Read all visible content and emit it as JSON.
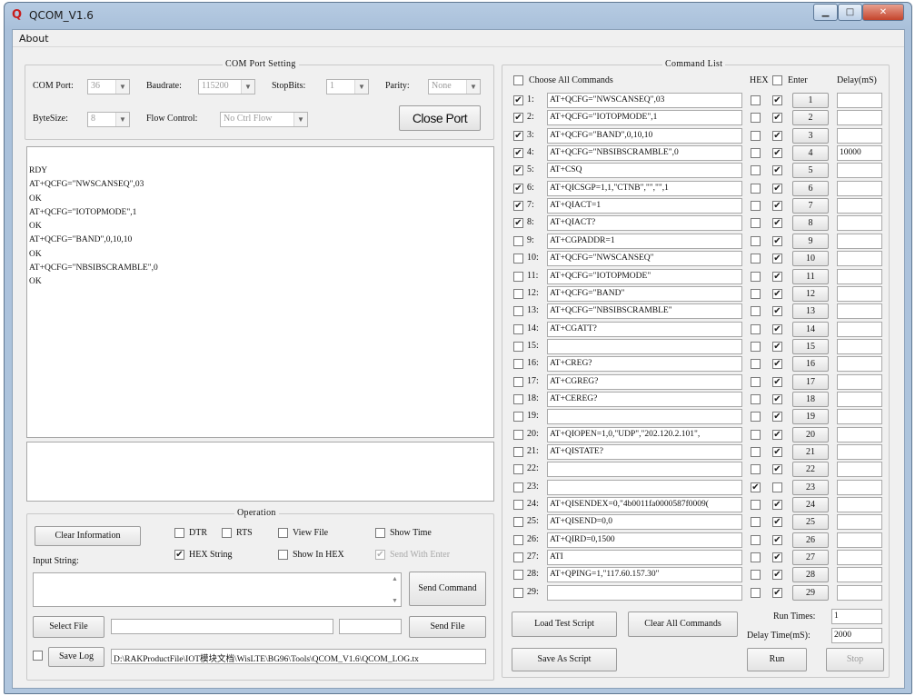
{
  "window": {
    "title": "QCOM_V1.6",
    "minimize_glyph": "▁",
    "maximize_glyph": "□",
    "close_glyph": "✕"
  },
  "menu": {
    "about": "About"
  },
  "com_port": {
    "group_title": "COM Port Setting",
    "port_label": "COM Port:",
    "port_value": "36",
    "baud_label": "Baudrate:",
    "baud_value": "115200",
    "stopbits_label": "StopBits:",
    "stopbits_value": "1",
    "parity_label": "Parity:",
    "parity_value": "None",
    "bytesize_label": "ByteSize:",
    "bytesize_value": "8",
    "flow_label": "Flow Control:",
    "flow_value": "No Ctrl Flow",
    "close_port": "Close Port"
  },
  "log": [
    "RDY",
    "AT+QCFG=\"NWSCANSEQ\",03",
    "OK",
    "AT+QCFG=\"IOTOPMODE\",1",
    "OK",
    "AT+QCFG=\"BAND\",0,10,10",
    "OK",
    "AT+QCFG=\"NBSIBSCRAMBLE\",0",
    "OK"
  ],
  "operation": {
    "group_title": "Operation",
    "clear_info": "Clear Information",
    "dtr": "DTR",
    "rts": "RTS",
    "view_file": "View File",
    "show_time": "Show Time",
    "hex_string": "HEX String",
    "show_in_hex": "Show In HEX",
    "send_with_enter": "Send With Enter",
    "input_string_label": "Input String:",
    "send_command": "Send Command",
    "select_file": "Select File",
    "send_file": "Send File",
    "save_log": "Save Log",
    "log_path": "D:\\RAKProductFile\\IOT模块文档\\WisLTE\\BG96\\Tools\\QCOM_V1.6\\QCOM_LOG.tx"
  },
  "commands": {
    "group_title": "Command List",
    "choose_all": "Choose All Commands",
    "hex_header": "HEX",
    "enter_header": "Enter",
    "delay_header": "Delay(mS)",
    "rows": [
      {
        "n": "1:",
        "cmd": "AT+QCFG=\"NWSCANSEQ\",03",
        "checked": true,
        "hex": false,
        "enter": true,
        "btn": "1",
        "delay": ""
      },
      {
        "n": "2:",
        "cmd": "AT+QCFG=\"IOTOPMODE\",1",
        "checked": true,
        "hex": false,
        "enter": true,
        "btn": "2",
        "delay": ""
      },
      {
        "n": "3:",
        "cmd": "AT+QCFG=\"BAND\",0,10,10",
        "checked": true,
        "hex": false,
        "enter": true,
        "btn": "3",
        "delay": ""
      },
      {
        "n": "4:",
        "cmd": "AT+QCFG=\"NBSIBSCRAMBLE\",0",
        "checked": true,
        "hex": false,
        "enter": true,
        "btn": "4",
        "delay": "10000"
      },
      {
        "n": "5:",
        "cmd": "AT+CSQ",
        "checked": true,
        "hex": false,
        "enter": true,
        "btn": "5",
        "delay": ""
      },
      {
        "n": "6:",
        "cmd": "AT+QICSGP=1,1,\"CTNB\",\"\",\"\",1",
        "checked": true,
        "hex": false,
        "enter": true,
        "btn": "6",
        "delay": ""
      },
      {
        "n": "7:",
        "cmd": "AT+QIACT=1",
        "checked": true,
        "hex": false,
        "enter": true,
        "btn": "7",
        "delay": ""
      },
      {
        "n": "8:",
        "cmd": "AT+QIACT?",
        "checked": true,
        "hex": false,
        "enter": true,
        "btn": "8",
        "delay": ""
      },
      {
        "n": "9:",
        "cmd": "AT+CGPADDR=1",
        "checked": false,
        "hex": false,
        "enter": true,
        "btn": "9",
        "delay": ""
      },
      {
        "n": "10:",
        "cmd": "AT+QCFG=\"NWSCANSEQ\"",
        "checked": false,
        "hex": false,
        "enter": true,
        "btn": "10",
        "delay": ""
      },
      {
        "n": "11:",
        "cmd": "AT+QCFG=\"IOTOPMODE\"",
        "checked": false,
        "hex": false,
        "enter": true,
        "btn": "11",
        "delay": ""
      },
      {
        "n": "12:",
        "cmd": "AT+QCFG=\"BAND\"",
        "checked": false,
        "hex": false,
        "enter": true,
        "btn": "12",
        "delay": ""
      },
      {
        "n": "13:",
        "cmd": "AT+QCFG=\"NBSIBSCRAMBLE\"",
        "checked": false,
        "hex": false,
        "enter": true,
        "btn": "13",
        "delay": ""
      },
      {
        "n": "14:",
        "cmd": "AT+CGATT?",
        "checked": false,
        "hex": false,
        "enter": true,
        "btn": "14",
        "delay": ""
      },
      {
        "n": "15:",
        "cmd": "",
        "checked": false,
        "hex": false,
        "enter": true,
        "btn": "15",
        "delay": ""
      },
      {
        "n": "16:",
        "cmd": "AT+CREG?",
        "checked": false,
        "hex": false,
        "enter": true,
        "btn": "16",
        "delay": ""
      },
      {
        "n": "17:",
        "cmd": "AT+CGREG?",
        "checked": false,
        "hex": false,
        "enter": true,
        "btn": "17",
        "delay": ""
      },
      {
        "n": "18:",
        "cmd": "AT+CEREG?",
        "checked": false,
        "hex": false,
        "enter": true,
        "btn": "18",
        "delay": ""
      },
      {
        "n": "19:",
        "cmd": "",
        "checked": false,
        "hex": false,
        "enter": true,
        "btn": "19",
        "delay": ""
      },
      {
        "n": "20:",
        "cmd": "AT+QIOPEN=1,0,\"UDP\",\"202.120.2.101\",",
        "checked": false,
        "hex": false,
        "enter": true,
        "btn": "20",
        "delay": ""
      },
      {
        "n": "21:",
        "cmd": "AT+QISTATE?",
        "checked": false,
        "hex": false,
        "enter": true,
        "btn": "21",
        "delay": ""
      },
      {
        "n": "22:",
        "cmd": "",
        "checked": false,
        "hex": false,
        "enter": true,
        "btn": "22",
        "delay": ""
      },
      {
        "n": "23:",
        "cmd": "",
        "checked": false,
        "hex": true,
        "enter": false,
        "btn": "23",
        "delay": ""
      },
      {
        "n": "24:",
        "cmd": "AT+QISENDEX=0,\"4b0011fa0000587f0009(",
        "checked": false,
        "hex": false,
        "enter": true,
        "btn": "24",
        "delay": ""
      },
      {
        "n": "25:",
        "cmd": "AT+QISEND=0,0",
        "checked": false,
        "hex": false,
        "enter": true,
        "btn": "25",
        "delay": ""
      },
      {
        "n": "26:",
        "cmd": "AT+QIRD=0,1500",
        "checked": false,
        "hex": false,
        "enter": true,
        "btn": "26",
        "delay": ""
      },
      {
        "n": "27:",
        "cmd": "ATI",
        "checked": false,
        "hex": false,
        "enter": true,
        "btn": "27",
        "delay": ""
      },
      {
        "n": "28:",
        "cmd": "AT+QPING=1,\"117.60.157.30\"",
        "checked": false,
        "hex": false,
        "enter": true,
        "btn": "28",
        "delay": ""
      },
      {
        "n": "29:",
        "cmd": "",
        "checked": false,
        "hex": false,
        "enter": true,
        "btn": "29",
        "delay": ""
      }
    ],
    "load_test_script": "Load Test Script",
    "clear_all_commands": "Clear All Commands",
    "save_as_script": "Save As Script",
    "run_times_label": "Run Times:",
    "run_times_value": "1",
    "delay_time_label": "Delay Time(mS):",
    "delay_time_value": "2000",
    "run": "Run",
    "stop": "Stop"
  },
  "checkmark": "✔"
}
